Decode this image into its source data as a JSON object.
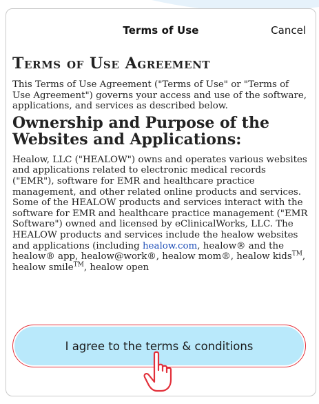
{
  "header": {
    "title": "Terms of Use",
    "cancel_label": "Cancel"
  },
  "document": {
    "heading": "Terms of Use Agreement",
    "intro": "This Terms of Use Agreement (\"Terms of Use\" or \"Terms of Use Agreement\") governs your access and use of the software, applications, and services as described below.",
    "section_title": "Ownership and Purpose of the Websites and Applications:",
    "body_before_link": "Healow, LLC (\"HEALOW\") owns and operates various websites and applications related to electronic medical records (\"EMR\"), software for EMR and healthcare practice management, and other related online products and services. Some of the HEALOW products and services interact with the software for EMR and healthcare practice management (\"EMR Software\") owned and licensed by eClinicalWorks, LLC. The HEALOW products and services include the healow websites and applications (including ",
    "link_text": "healow.com",
    "body_after_link": ", healow® and the healow® app, healow@work®, healow mom®, healow kids",
    "tm1": "TM",
    "body_mid": ", healow smile",
    "tm2": "TM",
    "body_end": ", healow open"
  },
  "agree_button": {
    "label": "I agree to the terms & conditions"
  },
  "colors": {
    "button_fill": "#b9e9fb",
    "button_outline": "#e2303a",
    "link": "#1f4fb8",
    "hand_outline": "#e2303a"
  },
  "icons": {
    "pointer": "pointing-hand-icon"
  }
}
